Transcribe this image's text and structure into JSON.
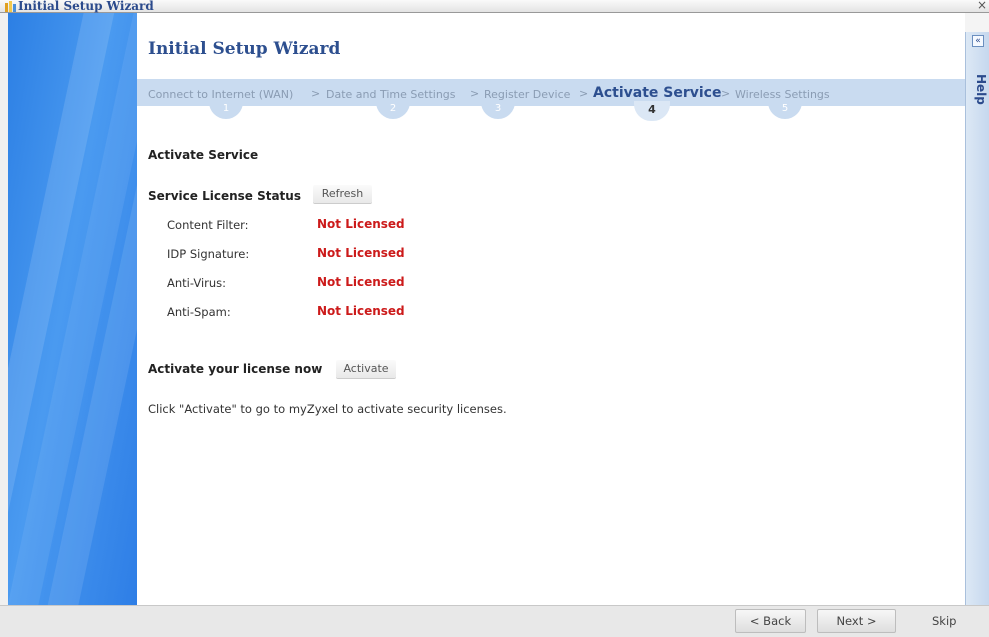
{
  "window": {
    "title": "Initial Setup Wizard",
    "close_glyph": "×",
    "icon": "wizard-icon"
  },
  "help": {
    "label": "Help",
    "collapse_glyph": "«"
  },
  "page": {
    "title": "Initial Setup Wizard"
  },
  "steps": [
    {
      "label": "Connect to Internet (WAN)",
      "number": "1",
      "active": false
    },
    {
      "label": "Date and Time Settings",
      "number": "2",
      "active": false
    },
    {
      "label": "Register Device",
      "number": "3",
      "active": false
    },
    {
      "label": "Activate Service",
      "number": "4",
      "active": true
    },
    {
      "label": "Wireless Settings",
      "number": "5",
      "active": false
    }
  ],
  "step_separator": ">",
  "section": {
    "title": "Activate Service"
  },
  "license_status": {
    "label": "Service License Status",
    "refresh_label": "Refresh",
    "items": [
      {
        "name": "Content Filter:",
        "status": "Not Licensed"
      },
      {
        "name": "IDP Signature:",
        "status": "Not Licensed"
      },
      {
        "name": "Anti-Virus:",
        "status": "Not Licensed"
      },
      {
        "name": "Anti-Spam:",
        "status": "Not Licensed"
      }
    ]
  },
  "activate": {
    "label": "Activate your license now",
    "button_label": "Activate",
    "info": "Click \"Activate\" to go to myZyxel to activate security licenses."
  },
  "footer": {
    "back_label": "< Back",
    "next_label": "Next >",
    "skip_label": "Skip"
  },
  "colors": {
    "accent": "#2d4f8f",
    "status_error": "#cc1a1a",
    "panel_blue": "#2c7fe4",
    "steps_band": "#c9dbf0"
  }
}
